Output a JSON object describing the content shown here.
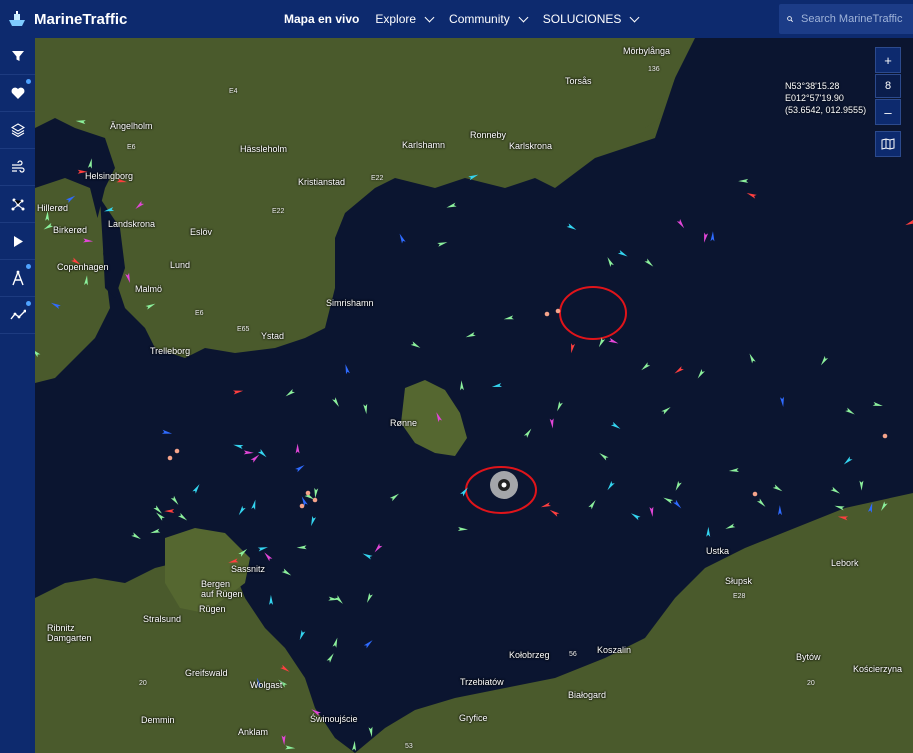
{
  "header": {
    "brand": "MarineTraffic",
    "nav": [
      {
        "label": "Mapa en vivo",
        "active": true,
        "dropdown": false
      },
      {
        "label": "Explore",
        "active": false,
        "dropdown": true
      },
      {
        "label": "Community",
        "active": false,
        "dropdown": true
      },
      {
        "label": "SOLUCIONES",
        "active": false,
        "dropdown": true
      }
    ],
    "search_placeholder": "Search MarineTraffic"
  },
  "sidebar": {
    "items": [
      {
        "icon": "filter-icon"
      },
      {
        "icon": "heart-icon"
      },
      {
        "icon": "layers-icon"
      },
      {
        "icon": "wind-icon"
      },
      {
        "icon": "routes-icon"
      },
      {
        "icon": "play-icon"
      },
      {
        "icon": "measure-icon"
      },
      {
        "icon": "analytics-icon"
      }
    ]
  },
  "map_controls": {
    "zoom_in": "+",
    "zoom_level": "8",
    "zoom_out": "–"
  },
  "coordinates": {
    "lat": "N53°38'15.28",
    "lon": "E012°57'19.90",
    "decimal": "(53.6542, 012.9555)"
  },
  "places": {
    "mobylanga": "Mörbylånga",
    "torsas": "Torsås",
    "angelholm": "Ängelholm",
    "hassleholm": "Hässleholm",
    "karlshamn": "Karlshamn",
    "ronneby": "Ronneby",
    "karlskrona": "Karlskrona",
    "kristianstad": "Kristianstad",
    "helsingborg": "Helsingborg",
    "hillerod": "Hillerød",
    "birkerod": "Birkerød",
    "landskrona": "Landskrona",
    "eslov": "Eslöv",
    "copenhagen": "Copenhagen",
    "lund": "Lund",
    "malmo": "Malmö",
    "simrishamn": "Simrishamn",
    "ystad": "Ystad",
    "trelleborg": "Trelleborg",
    "ronne": "Rønne",
    "ustka": "Ustka",
    "lebork": "Lebork",
    "slupsk": "Słupsk",
    "sassnitz": "Sassnitz",
    "bergen": "Bergen\nauf Rügen",
    "rugen": "Rügen",
    "stralsund": "Stralsund",
    "ribnitz": "Ribnitz\nDamgarten",
    "greifswald": "Greifswald",
    "wolgast": "Wolgast",
    "demmin": "Demmin",
    "anklam": "Anklam",
    "swinoujscie": "Świnoujście",
    "kolobrzeg": "Kołobrzeg",
    "koszalin": "Koszalin",
    "bytow": "Bytów",
    "koscierzyna": "Kościerzyna",
    "trzebiatow": "Trzebiatów",
    "bialogard": "Białogard",
    "gryfice": "Gryfice"
  },
  "roads": [
    "E4",
    "E6",
    "E22",
    "E22",
    "E65",
    "E6",
    "136",
    "20",
    "20",
    "56",
    "53",
    "E28"
  ],
  "colors": {
    "header": "#0d2a6e",
    "sea": "#0b1530",
    "annotation": "#e0141a",
    "cargo_vessel": "#8cf09c",
    "tanker_vessel": "#ff3f3f",
    "passenger_vessel": "#2f6bff",
    "pleasure_vessel": "#e346d8",
    "tug_vessel": "#34d5f0"
  }
}
